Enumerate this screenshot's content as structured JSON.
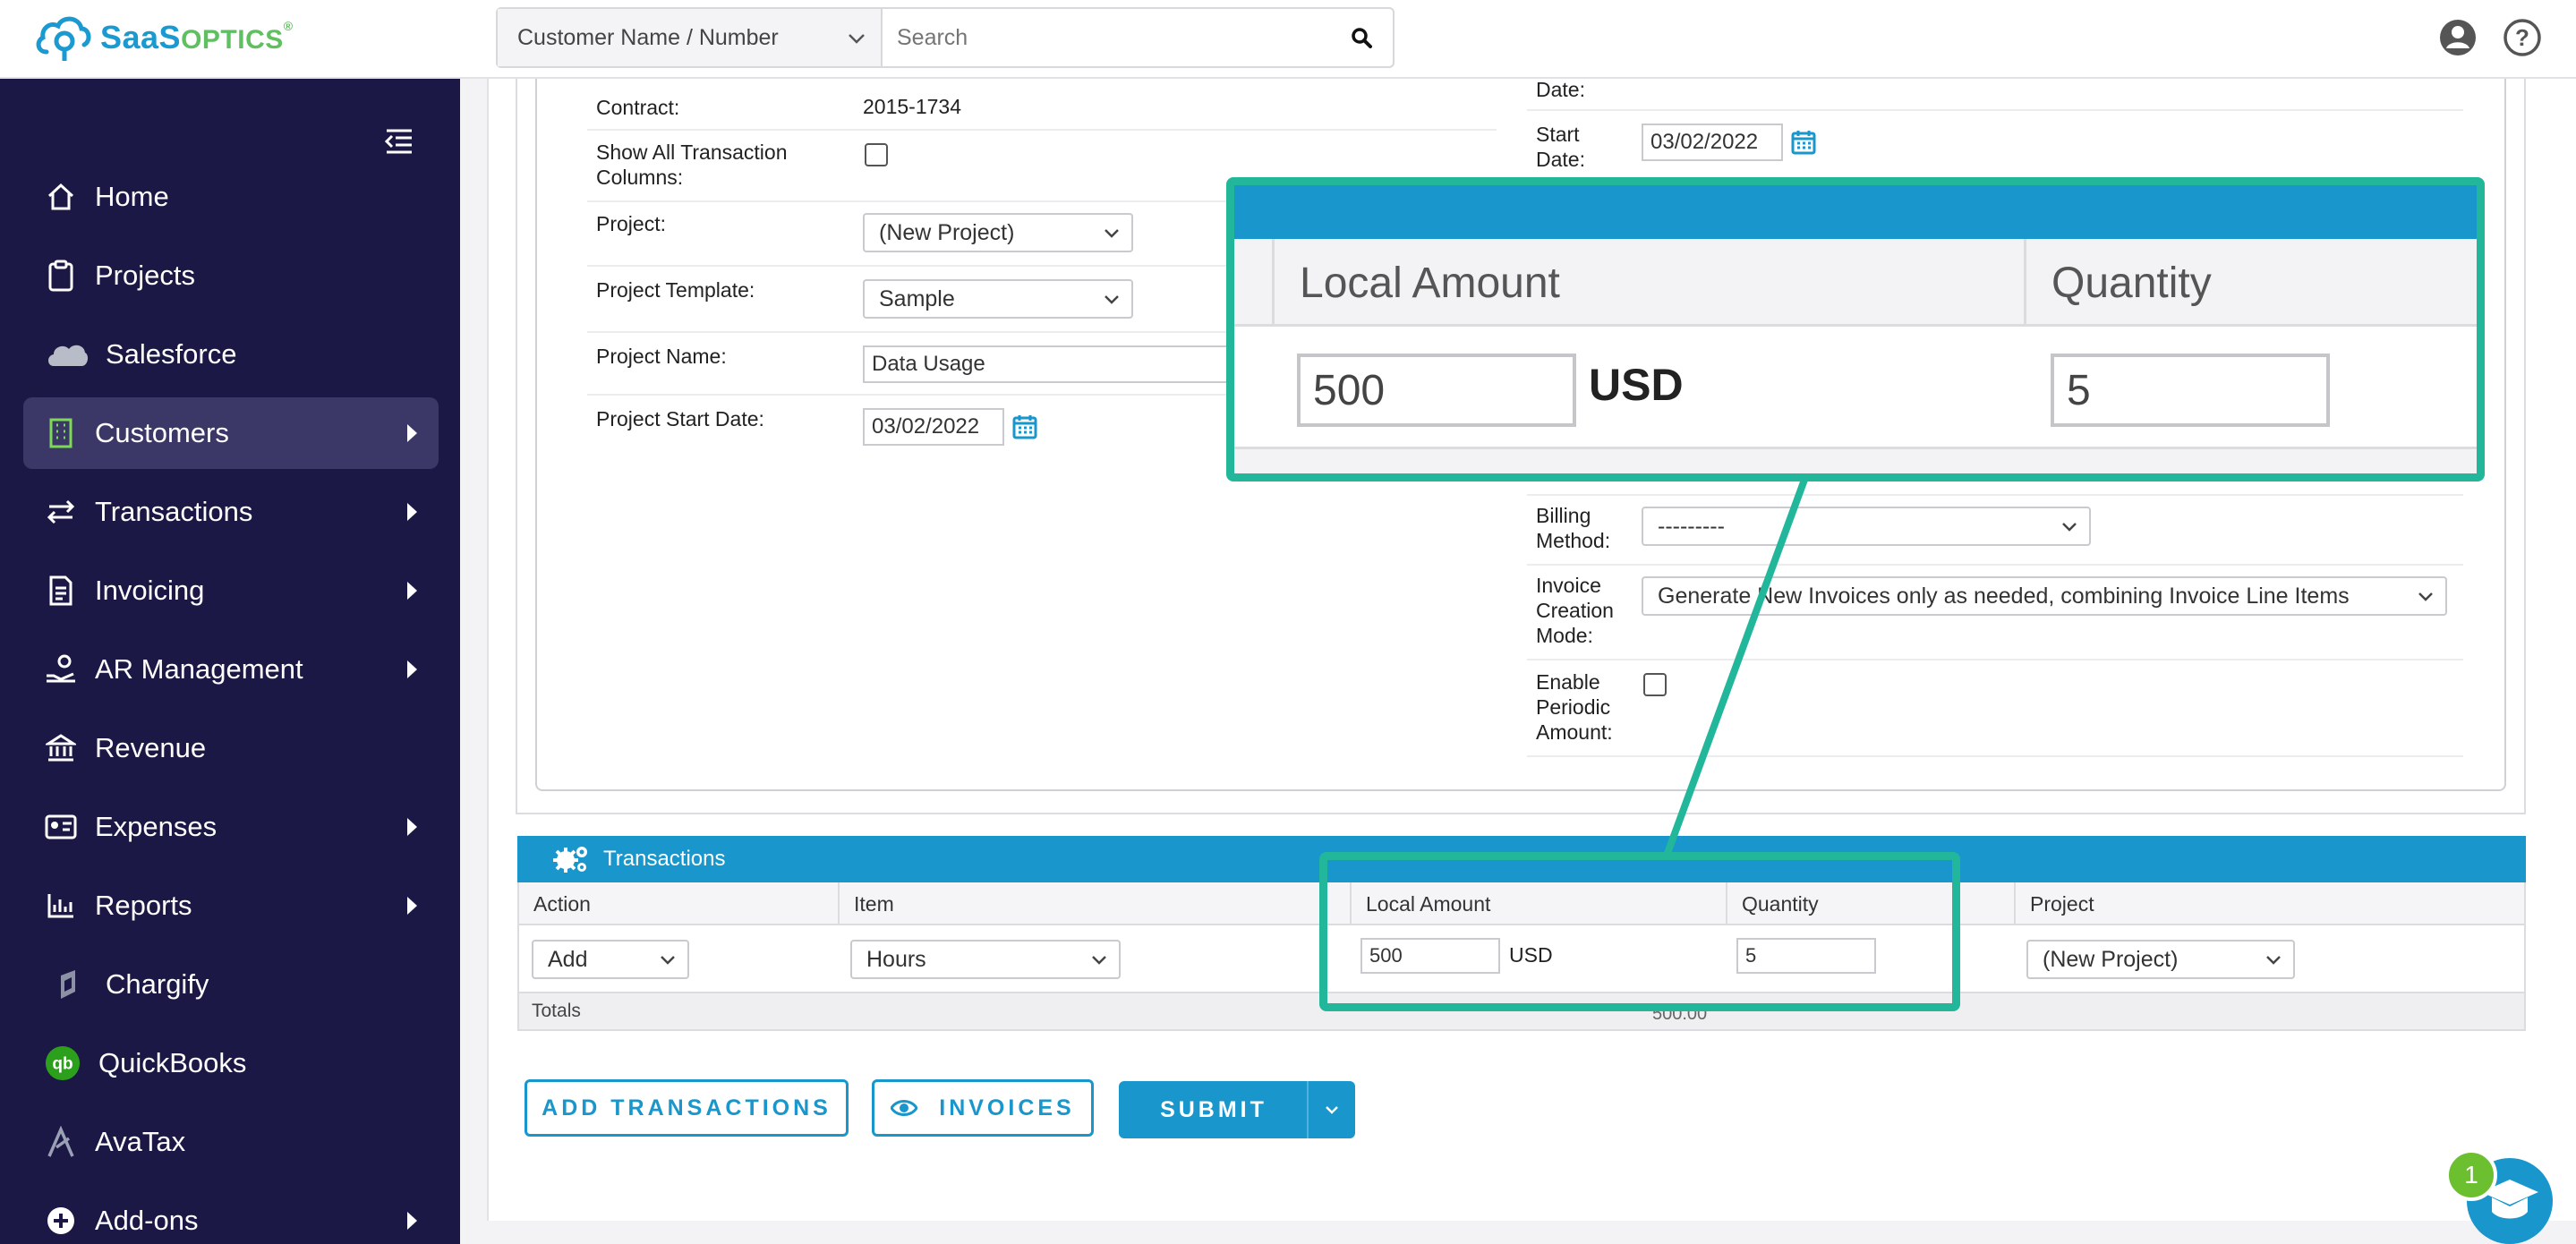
{
  "brand": {
    "name_part1": "SaaS",
    "name_part2": "OPTICS",
    "trademark": "®"
  },
  "search": {
    "scope": "Customer Name / Number",
    "placeholder": "Search"
  },
  "sidebar": {
    "items": [
      {
        "label": "Home",
        "icon": "home-icon",
        "has_arrow": false
      },
      {
        "label": "Projects",
        "icon": "clipboard-icon",
        "has_arrow": false
      },
      {
        "label": "Salesforce",
        "icon": "salesforce-icon",
        "has_arrow": false
      },
      {
        "label": "Customers",
        "icon": "building-icon",
        "has_arrow": true,
        "active": true
      },
      {
        "label": "Transactions",
        "icon": "exchange-icon",
        "has_arrow": true
      },
      {
        "label": "Invoicing",
        "icon": "invoice-icon",
        "has_arrow": true
      },
      {
        "label": "AR Management",
        "icon": "hand-coin-icon",
        "has_arrow": true
      },
      {
        "label": "Revenue",
        "icon": "bank-icon",
        "has_arrow": false
      },
      {
        "label": "Expenses",
        "icon": "id-card-icon",
        "has_arrow": true
      },
      {
        "label": "Reports",
        "icon": "bar-chart-icon",
        "has_arrow": true
      },
      {
        "label": "Chargify",
        "icon": "chargify-icon",
        "has_arrow": false
      },
      {
        "label": "QuickBooks",
        "icon": "quickbooks-icon",
        "has_arrow": false
      },
      {
        "label": "AvaTax",
        "icon": "avatax-icon",
        "has_arrow": false
      },
      {
        "label": "Add-ons",
        "icon": "plus-circle-icon",
        "has_arrow": true
      }
    ]
  },
  "form_left": {
    "contract_label": "Contract:",
    "contract_value": "2015-1734",
    "show_all_label_1": "Show All Transaction",
    "show_all_label_2": "Columns:",
    "project_label": "Project:",
    "project_value": "(New Project)",
    "template_label": "Project Template:",
    "template_value": "Sample",
    "name_label": "Project Name:",
    "name_value": "Data Usage",
    "start_label": "Project Start Date:",
    "start_value": "03/02/2022"
  },
  "form_right": {
    "date_label_partial": "Date:",
    "start_label_1": "Start",
    "start_label_2": "Date:",
    "start_value": "03/02/2022",
    "billing_label_1": "Billing",
    "billing_label_2": "Method:",
    "billing_value": "---------",
    "invoice_mode_label_1": "Invoice",
    "invoice_mode_label_2": "Creation",
    "invoice_mode_label_3": "Mode:",
    "invoice_mode_value": "Generate New Invoices only as needed, combining Invoice Line Items",
    "periodic_label_1": "Enable",
    "periodic_label_2": "Periodic",
    "periodic_label_3": "Amount:"
  },
  "transactions": {
    "title": "Transactions",
    "columns": [
      "Action",
      "Item",
      "Local Amount",
      "Quantity",
      "Project"
    ],
    "row": {
      "action": "Add",
      "item": "Hours",
      "amount": "500",
      "currency": "USD",
      "quantity": "5",
      "project": "(New Project)"
    },
    "totals_label": "Totals",
    "totals_value": "500.00"
  },
  "buttons": {
    "add_transactions": "ADD TRANSACTIONS",
    "invoices": "INVOICES",
    "submit": "SUBMIT"
  },
  "zoom": {
    "col_amount": "Local Amount",
    "col_quantity": "Quantity",
    "amount": "500",
    "currency": "USD",
    "quantity": "5"
  },
  "help": {
    "notification_count": "1"
  },
  "colors": {
    "sidebar": "#1b1845",
    "accent": "#1996cc",
    "highlight": "#22b79a"
  }
}
